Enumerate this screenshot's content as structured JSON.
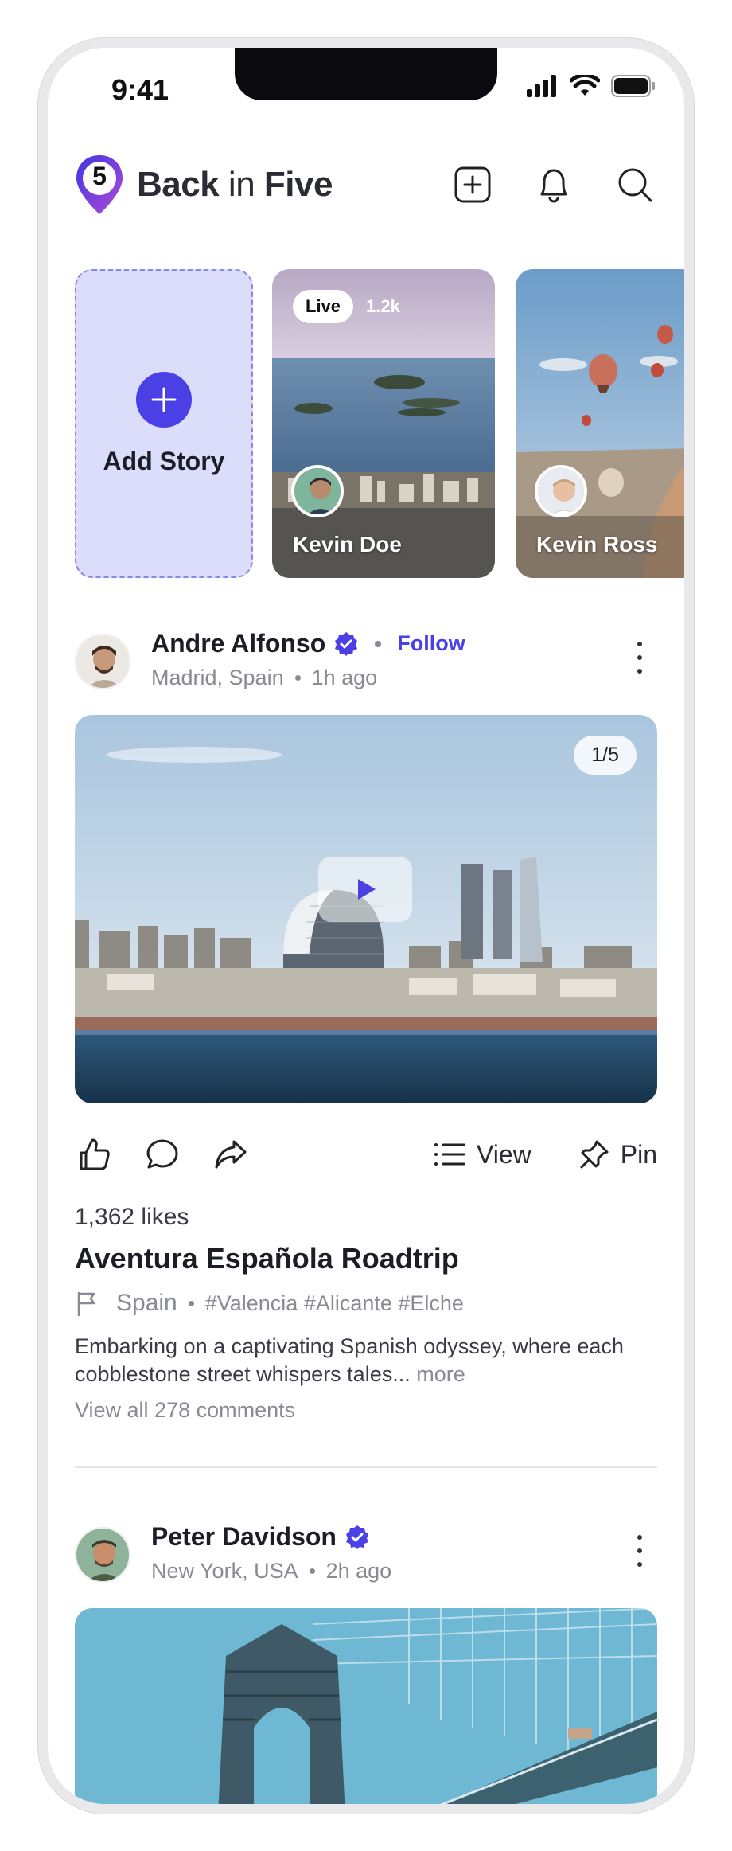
{
  "status_bar": {
    "time": "9:41"
  },
  "header": {
    "logo_number": "5",
    "brand_bold_1": "Back",
    "brand_light": " in ",
    "brand_bold_2": "Five",
    "icons": [
      "add-post-icon",
      "bell-icon",
      "search-icon"
    ]
  },
  "stories": {
    "add_label": "Add Story",
    "items": [
      {
        "name": "Kevin Doe",
        "live_label": "Live",
        "viewers": "1.2k"
      },
      {
        "name": "Kevin Ross"
      }
    ]
  },
  "posts": [
    {
      "author": "Andre Alfonso",
      "verified": true,
      "follow_label": "Follow",
      "location": "Madrid, Spain",
      "time_ago": "1h ago",
      "media_counter": "1/5",
      "view_label": "View",
      "pin_label": "Pin",
      "likes": "1,362 likes",
      "title": "Aventura Española Roadtrip",
      "country": "Spain",
      "tags": "#Valencia #Alicante #Elche",
      "description": "Embarking on a captivating Spanish odyssey, where each cobblestone street whispers tales...",
      "more_label": " more",
      "comments_label": "View all 278 comments"
    },
    {
      "author": "Peter Davidson",
      "verified": true,
      "location": "New York, USA",
      "time_ago": "2h ago"
    }
  ],
  "colors": {
    "accent": "#4a40e6",
    "story_bg": "#dcdcfb",
    "muted": "#8a8a95"
  }
}
